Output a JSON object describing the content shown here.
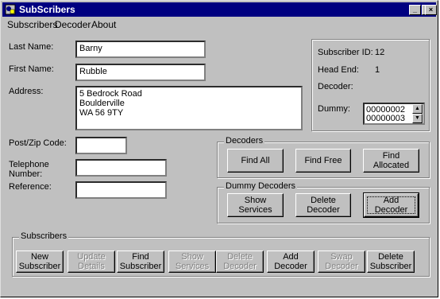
{
  "window": {
    "title": "SubScribers",
    "icon": "app-icon"
  },
  "title_buttons": {
    "minimize": "_",
    "maximize": "□",
    "close": "×"
  },
  "menu": [
    "Subscribers",
    "Decoder",
    "About"
  ],
  "form": {
    "last_name_label": "Last Name:",
    "last_name_value": "Barny",
    "first_name_label": "First Name:",
    "first_name_value": "Rubble",
    "address_label": "Address:",
    "address_value": "5 Bedrock Road\nBoulderville\nWA 56 9TY",
    "post_label": "Post/Zip Code:",
    "post_value": "",
    "telephone_label": "Telephone\nNumber:",
    "telephone_value": "",
    "reference_label": "Reference:",
    "reference_value": ""
  },
  "info": {
    "subscriber_id_label": "Subscriber ID:",
    "subscriber_id_value": "12",
    "head_end_label": "Head End:",
    "head_end_value": "1",
    "decoder_label": "Decoder:",
    "dummy_label": "Dummy:",
    "dummy_values": [
      "00000002",
      "00000003"
    ]
  },
  "decoders": {
    "title": "Decoders",
    "buttons": [
      "Find All",
      "Find Free",
      "Find Allocated"
    ]
  },
  "dummy_decoders": {
    "title": "Dummy Decoders",
    "buttons": [
      "Show Services",
      "Delete\nDecoder",
      "Add Decoder"
    ]
  },
  "subscribers": {
    "title": "Subscribers",
    "buttons": [
      {
        "label": "New\nSubscriber",
        "enabled": true
      },
      {
        "label": "Update\nDetails",
        "enabled": false
      },
      {
        "label": "Find\nSubscriber",
        "enabled": true
      },
      {
        "label": "Show\nServices",
        "enabled": false
      },
      {
        "label": "Delete\nDecoder",
        "enabled": false
      },
      {
        "label": "Add\nDecoder",
        "enabled": true
      },
      {
        "label": "Swap\nDecoder",
        "enabled": false
      },
      {
        "label": "Delete\nSubscriber",
        "enabled": true
      }
    ]
  }
}
